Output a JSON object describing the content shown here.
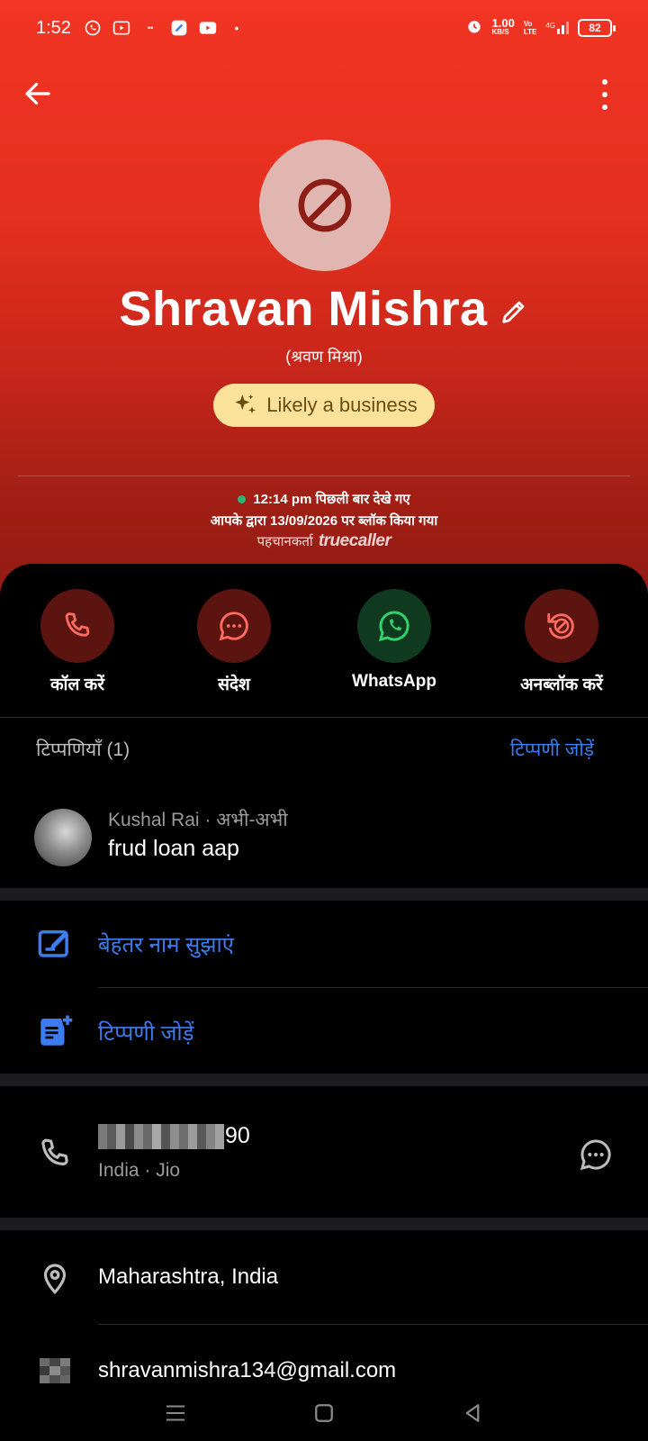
{
  "status_bar": {
    "time": "1:52",
    "speed_value": "1.00",
    "speed_unit": "KB/S",
    "network": "4G",
    "volte_top": "Vo",
    "volte_bottom": "LTE",
    "battery": "82"
  },
  "contact": {
    "name": "Shravan Mishra",
    "alt_name": "(श्रवण मिश्रा)",
    "badge": "Likely a business",
    "last_seen": "12:14 pm पिछली बार देखे गए",
    "blocked_info": "आपके द्वारा 13/09/2026 पर ब्लॉक किया गया",
    "identified_by": "पहचानकर्ता",
    "identifier_logo": "truecaller"
  },
  "actions": {
    "call": "कॉल करें",
    "message": "संदेश",
    "whatsapp": "WhatsApp",
    "unblock": "अनब्लॉक करें"
  },
  "comments": {
    "header": "टिप्पणियाँ (1)",
    "add_link": "टिप्पणी जोड़ें",
    "items": [
      {
        "author": "Kushal Rai",
        "time": "अभी-अभी",
        "text": "frud loan aap"
      }
    ]
  },
  "options": {
    "suggest_name": "बेहतर नाम सुझाएं",
    "add_note": "टिप्पणी जोड़ें"
  },
  "phone": {
    "number_suffix": "90",
    "details": "India · Jio"
  },
  "address": "Maharashtra, India",
  "email": "shravanmishra134@gmail.com",
  "colors": {
    "header_red": "#f23524",
    "accent_blue": "#3d7cf0",
    "badge_yellow": "#fbe29b",
    "online_green": "#2bb673"
  }
}
